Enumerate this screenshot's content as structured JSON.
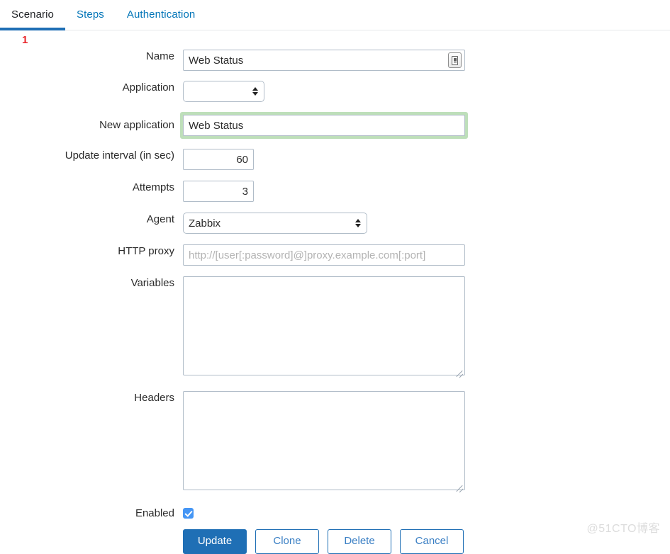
{
  "tabs": [
    {
      "label": "Scenario",
      "active": true
    },
    {
      "label": "Steps",
      "active": false
    },
    {
      "label": "Authentication",
      "active": false
    }
  ],
  "annotation": {
    "marker": "1",
    "color": "#e8262b"
  },
  "form": {
    "name": {
      "label": "Name",
      "value": "Web Status",
      "icon": "document-picker-icon"
    },
    "application": {
      "label": "Application",
      "value": "",
      "options": [
        ""
      ]
    },
    "new_application": {
      "label": "New application",
      "value": "Web Status",
      "highlight_color": "#bedfba"
    },
    "update_interval": {
      "label": "Update interval (in sec)",
      "value": "60"
    },
    "attempts": {
      "label": "Attempts",
      "value": "3"
    },
    "agent": {
      "label": "Agent",
      "value": "Zabbix",
      "options": [
        "Zabbix"
      ]
    },
    "http_proxy": {
      "label": "HTTP proxy",
      "value": "",
      "placeholder": "http://[user[:password]@]proxy.example.com[:port]"
    },
    "variables": {
      "label": "Variables",
      "value": "",
      "placeholder": ""
    },
    "headers": {
      "label": "Headers",
      "value": "",
      "placeholder": ""
    },
    "enabled": {
      "label": "Enabled",
      "checked": true
    }
  },
  "buttons": {
    "update": "Update",
    "clone": "Clone",
    "delete": "Delete",
    "cancel": "Cancel"
  },
  "watermark": "@51CTO博客",
  "colors": {
    "accent": "#1f6fb5",
    "link": "#0275b8",
    "highlight": "#bedfba",
    "marker": "#e8262b",
    "checkbox": "#4596f5"
  }
}
